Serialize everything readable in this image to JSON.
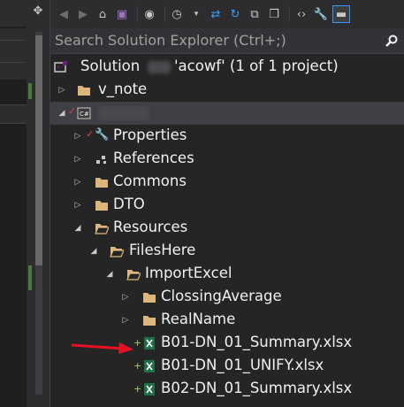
{
  "search": {
    "placeholder": "Search Solution Explorer (Ctrl+;)"
  },
  "solution": {
    "label_prefix": "Solution",
    "label_suffix": "'acowf' (1 of 1 project)"
  },
  "tree": {
    "vs_note": "v_note",
    "project": "",
    "properties": "Properties",
    "references": "References",
    "commons": "Commons",
    "dto": "DTO",
    "resources": "Resources",
    "fileshere": "FilesHere",
    "importexcel": "ImportExcel",
    "closingaverage": "ClossingAverage",
    "realname": "RealName",
    "file1": "B01-DN_01_Summary.xlsx",
    "file2": "B01-DN_01_UNIFY.xlsx",
    "file3": "B02-DN_01_Summary.xlsx"
  },
  "colors": {
    "folder": "#dcb67a",
    "excel": "#1e7145",
    "accent": "#3399ff",
    "arrow": "#e81123"
  }
}
